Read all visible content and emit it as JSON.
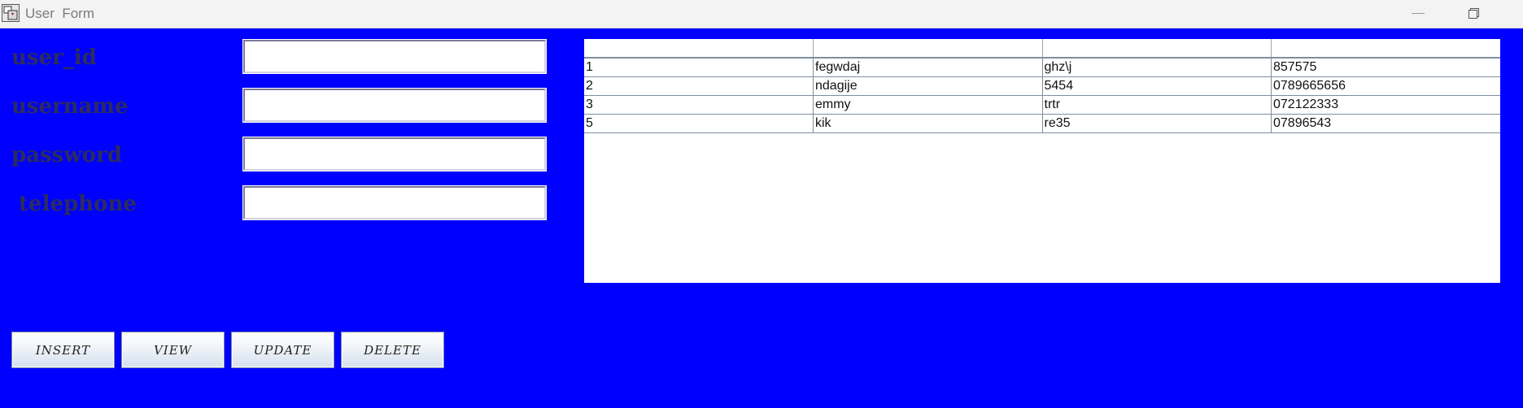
{
  "window": {
    "title": "User  Form",
    "icons": [
      "java-app-icon",
      "minimize-icon",
      "restore-icon"
    ]
  },
  "form": {
    "fields": [
      {
        "label": "user_id",
        "value": ""
      },
      {
        "label": "username",
        "value": ""
      },
      {
        "label": "password",
        "value": ""
      },
      {
        "label": " telephone",
        "value": ""
      }
    ]
  },
  "table": {
    "columns": [
      "",
      "",
      "",
      ""
    ],
    "rows": [
      [
        "1",
        "fegwdaj",
        "ghz\\j",
        "857575"
      ],
      [
        "2",
        "ndagije",
        "5454",
        "0789665656"
      ],
      [
        "3",
        "emmy",
        "trtr",
        "072122333"
      ],
      [
        "5",
        "kik",
        "re35",
        "07896543"
      ]
    ]
  },
  "buttons": {
    "insert": "INSERT",
    "view": "VIEW",
    "update": "UPDATE",
    "delete": "DELETE"
  },
  "colors": {
    "background": "#0000ff",
    "label": "#2c2c5e",
    "titlebar": "#f3f3f3"
  }
}
